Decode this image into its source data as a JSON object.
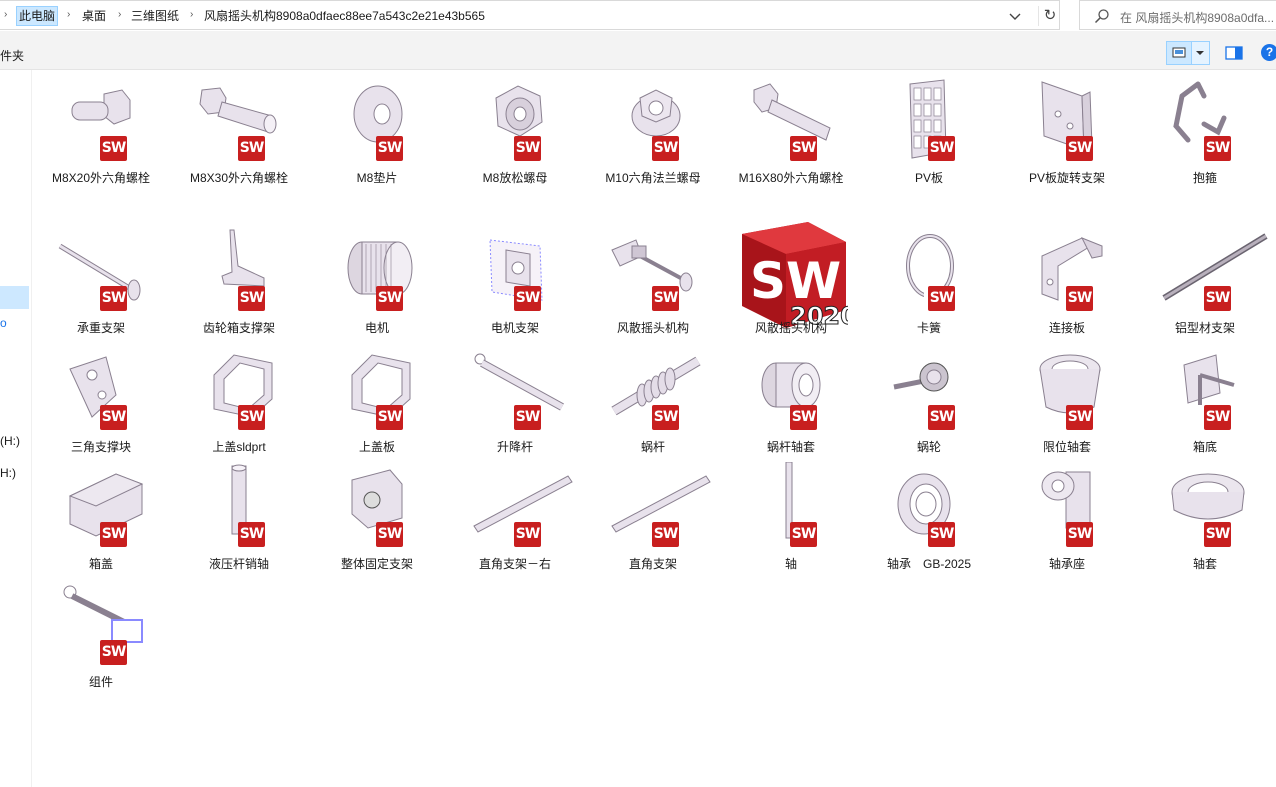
{
  "address": {
    "crumbs": [
      "此电脑",
      "桌面",
      "三维图纸",
      "风扇摇头机构8908a0dfaec88ee7a543c2e21e43b565"
    ]
  },
  "search": {
    "placeholder": "在 风扇摇头机构8908a0dfa..."
  },
  "toolbar": {
    "new_folder_label": "件夹",
    "help_label": "?"
  },
  "nav": {
    "items": [
      "(H:)",
      "H:)"
    ]
  },
  "files": [
    {
      "name": "M8X20外六角螺栓",
      "icon": "bolt-short"
    },
    {
      "name": "M8X30外六角螺栓",
      "icon": "bolt-medium"
    },
    {
      "name": "M8垫片",
      "icon": "washer"
    },
    {
      "name": "M8放松螺母",
      "icon": "lock-nut"
    },
    {
      "name": "M10六角法兰螺母",
      "icon": "flange-nut"
    },
    {
      "name": "M16X80外六角螺栓",
      "icon": "bolt-long"
    },
    {
      "name": "PV板",
      "icon": "grid-plate"
    },
    {
      "name": "PV板旋转支架",
      "icon": "bracket-plate"
    },
    {
      "name": "抱箍",
      "icon": "hoop"
    },
    {
      "name": "承重支架",
      "icon": "rod"
    },
    {
      "name": "齿轮箱支撑架",
      "icon": "stand"
    },
    {
      "name": "电机",
      "icon": "motor"
    },
    {
      "name": "电机支架",
      "icon": "motor-mount"
    },
    {
      "name": "风散摇头机构",
      "icon": "assembly"
    },
    {
      "name": "风散摇头机构",
      "icon": "sw2020-logo"
    },
    {
      "name": "卡簧",
      "icon": "circlip"
    },
    {
      "name": "连接板",
      "icon": "connect-plate"
    },
    {
      "name": "铝型材支架",
      "icon": "profile-bar"
    },
    {
      "name": "三角支撑块",
      "icon": "triangle-block"
    },
    {
      "name": "上盖sldprt",
      "icon": "cover"
    },
    {
      "name": "上盖板",
      "icon": "cover"
    },
    {
      "name": "升降杆",
      "icon": "lift-rod"
    },
    {
      "name": "蜗杆",
      "icon": "worm"
    },
    {
      "name": "蜗杆轴套",
      "icon": "bushing"
    },
    {
      "name": "蜗轮",
      "icon": "worm-gear"
    },
    {
      "name": "限位轴套",
      "icon": "limit-sleeve"
    },
    {
      "name": "箱底",
      "icon": "box-base"
    },
    {
      "name": "箱盖",
      "icon": "box-lid"
    },
    {
      "name": "液压杆销轴",
      "icon": "pin"
    },
    {
      "name": "整体固定支架",
      "icon": "fixed-bracket"
    },
    {
      "name": "直角支架－右",
      "icon": "angle-bar"
    },
    {
      "name": "直角支架",
      "icon": "angle-bar"
    },
    {
      "name": "轴",
      "icon": "shaft"
    },
    {
      "name": "轴承　GB-2025",
      "icon": "bearing"
    },
    {
      "name": "轴承座",
      "icon": "bearing-seat"
    },
    {
      "name": "轴套",
      "icon": "sleeve"
    },
    {
      "name": "组件",
      "icon": "component"
    }
  ],
  "badge_text": "SW",
  "logo": {
    "letters": "SW",
    "version": "2020"
  },
  "colors": {
    "badge": "#c81f1f",
    "selected": "#cce8ff",
    "part": "#e8e2ec",
    "part_edge": "#8a8090"
  }
}
